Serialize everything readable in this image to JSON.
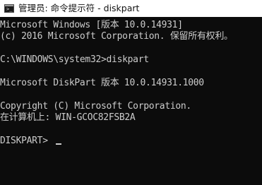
{
  "window": {
    "title": "管理员: 命令提示符 - diskpart",
    "icon": "cmd-icon"
  },
  "console": {
    "lines": [
      "Microsoft Windows [版本 10.0.14931]",
      "(c) 2016 Microsoft Corporation. 保留所有权利。",
      "C:\\WINDOWS\\system32>diskpart",
      "Microsoft DiskPart 版本 10.0.14931.1000",
      "Copyright (C) Microsoft Corporation.",
      "在计算机上: WIN-GCOC82FSB2A",
      "DISKPART> "
    ]
  },
  "colors": {
    "background": "#0c0c0c",
    "text": "#cccccc",
    "titlebar": "#ffffff"
  }
}
